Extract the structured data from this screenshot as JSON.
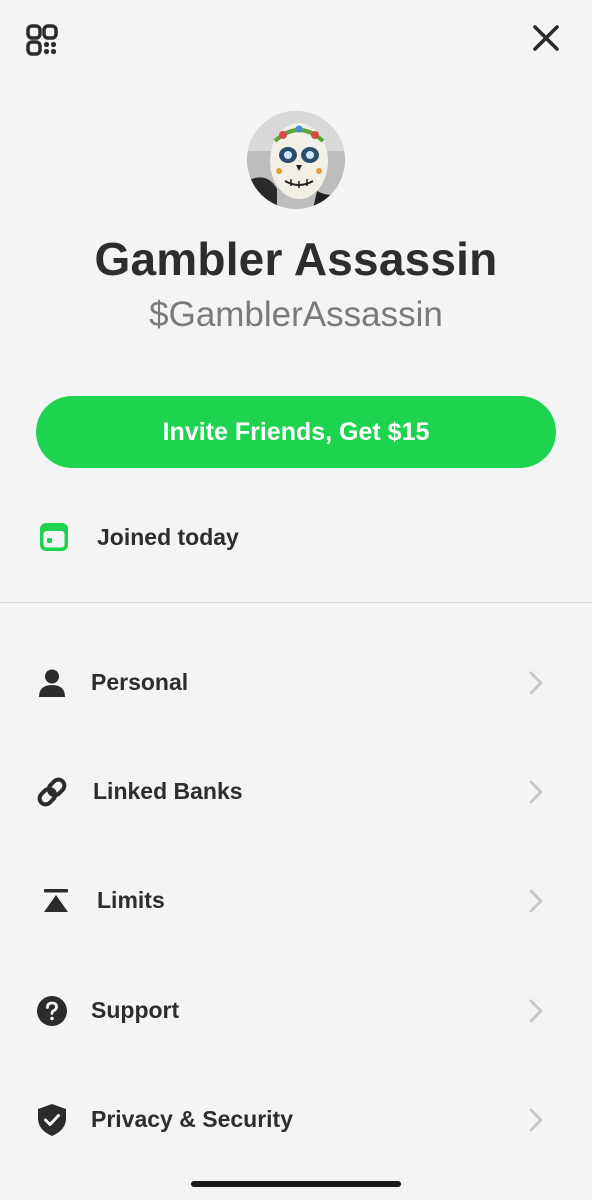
{
  "header": {
    "qr_icon": "qr-code-icon",
    "close_icon": "close-icon"
  },
  "profile": {
    "avatar": "skull-mask-avatar",
    "display_name": "Gambler Assassin",
    "cashtag": "$GamblerAssassin"
  },
  "invite": {
    "label": "Invite Friends, Get $15",
    "color": "#1ed34f"
  },
  "joined": {
    "icon": "calendar-icon",
    "label": "Joined today",
    "icon_color": "#1ed34f"
  },
  "menu": {
    "items": [
      {
        "label": "Personal",
        "icon": "person-icon"
      },
      {
        "label": "Linked Banks",
        "icon": "link-icon"
      },
      {
        "label": "Limits",
        "icon": "limits-icon"
      },
      {
        "label": "Support",
        "icon": "question-icon"
      },
      {
        "label": "Privacy & Security",
        "icon": "shield-icon"
      }
    ],
    "chevron_icon": "chevron-right-icon"
  }
}
